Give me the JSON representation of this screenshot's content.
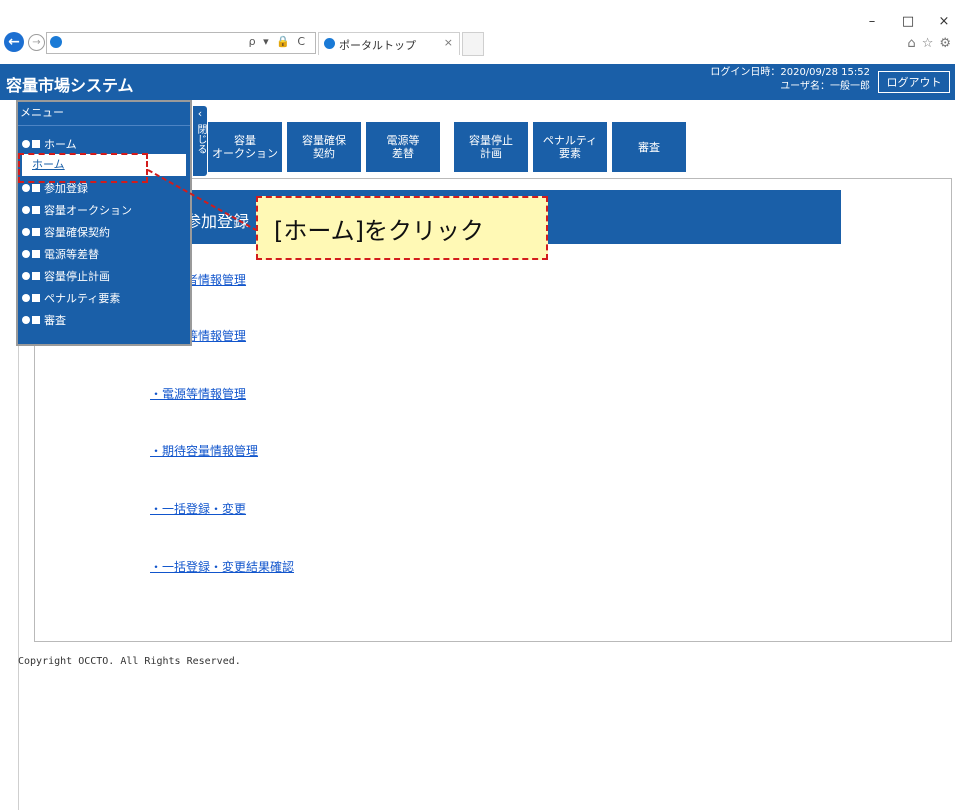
{
  "browser": {
    "tab_title": "ポータルトップ",
    "tab_close": "×",
    "back": "←",
    "forward": "→",
    "addr_tools": "ρ ▾ 🔒 C",
    "window_controls": [
      "–",
      "□",
      "×"
    ],
    "toolbar_icons": [
      "⌂",
      "☆",
      "⚙"
    ]
  },
  "header": {
    "title": "容量市場システム",
    "login_time": "ログイン日時：2020/09/28 15:52",
    "user_name": "ユーザ名：一般一郎",
    "logout_label": "ログアウト"
  },
  "collapse": {
    "arrow": "‹",
    "label": "閉じる"
  },
  "function_buttons": [
    {
      "label": "容量\nオークション"
    },
    {
      "label": "容量確保\n契約"
    },
    {
      "label": "電源等\n差替"
    },
    {
      "label": "容量停止\n計画"
    },
    {
      "label": "ペナルティ\n要素"
    },
    {
      "label": "審査"
    }
  ],
  "side_menu": {
    "title": "メニュー",
    "items": [
      {
        "label": "ホーム"
      },
      {
        "label": "参加登録"
      },
      {
        "label": "容量オークション"
      },
      {
        "label": "容量確保契約"
      },
      {
        "label": "電源等差替"
      },
      {
        "label": "容量停止計画"
      },
      {
        "label": "ペナルティ要素"
      },
      {
        "label": "審査"
      }
    ],
    "submenu_home": "ホーム"
  },
  "main": {
    "section_title": "参加登録",
    "links": [
      {
        "label": "・事業者情報管理"
      },
      {
        "label": "・電源等情報管理"
      },
      {
        "label": "・電源等情報管理"
      },
      {
        "label": "・期待容量情報管理"
      },
      {
        "label": "・一括登録・変更"
      },
      {
        "label": "・一括登録・変更結果確認"
      }
    ]
  },
  "footer": {
    "copyright": "Copyright OCCTO. All Rights Reserved."
  },
  "annotation": {
    "callout_text": "[ホーム]をクリック"
  },
  "colors": {
    "brand_blue": "#1a5fa8",
    "callout_bg": "#fff9b5",
    "highlight_red": "#d21c1c",
    "link_blue": "#1155cc"
  }
}
